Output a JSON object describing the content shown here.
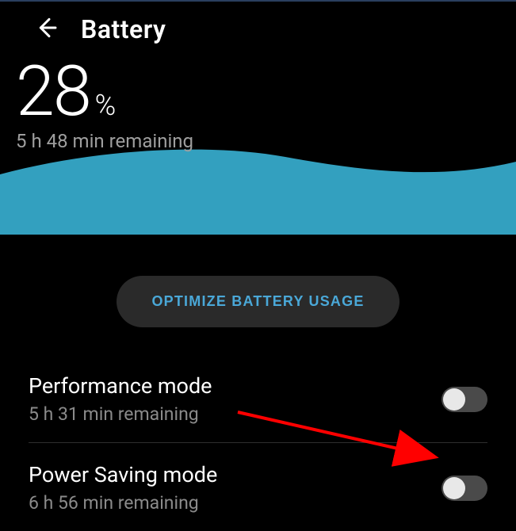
{
  "header": {
    "title": "Battery"
  },
  "battery": {
    "percent_value": "28",
    "percent_sign": "%",
    "remaining": "5 h 48 min remaining"
  },
  "optimize": {
    "label": "OPTIMIZE BATTERY USAGE"
  },
  "modes": {
    "performance": {
      "title": "Performance mode",
      "subtitle": "5 h 31 min remaining",
      "on": false
    },
    "power_saving": {
      "title": "Power Saving mode",
      "subtitle": "6 h 56 min remaining",
      "on": false
    }
  },
  "colors": {
    "accent": "#4aa8d8",
    "wave": "#33a0bf",
    "arrow": "#ff0000"
  }
}
